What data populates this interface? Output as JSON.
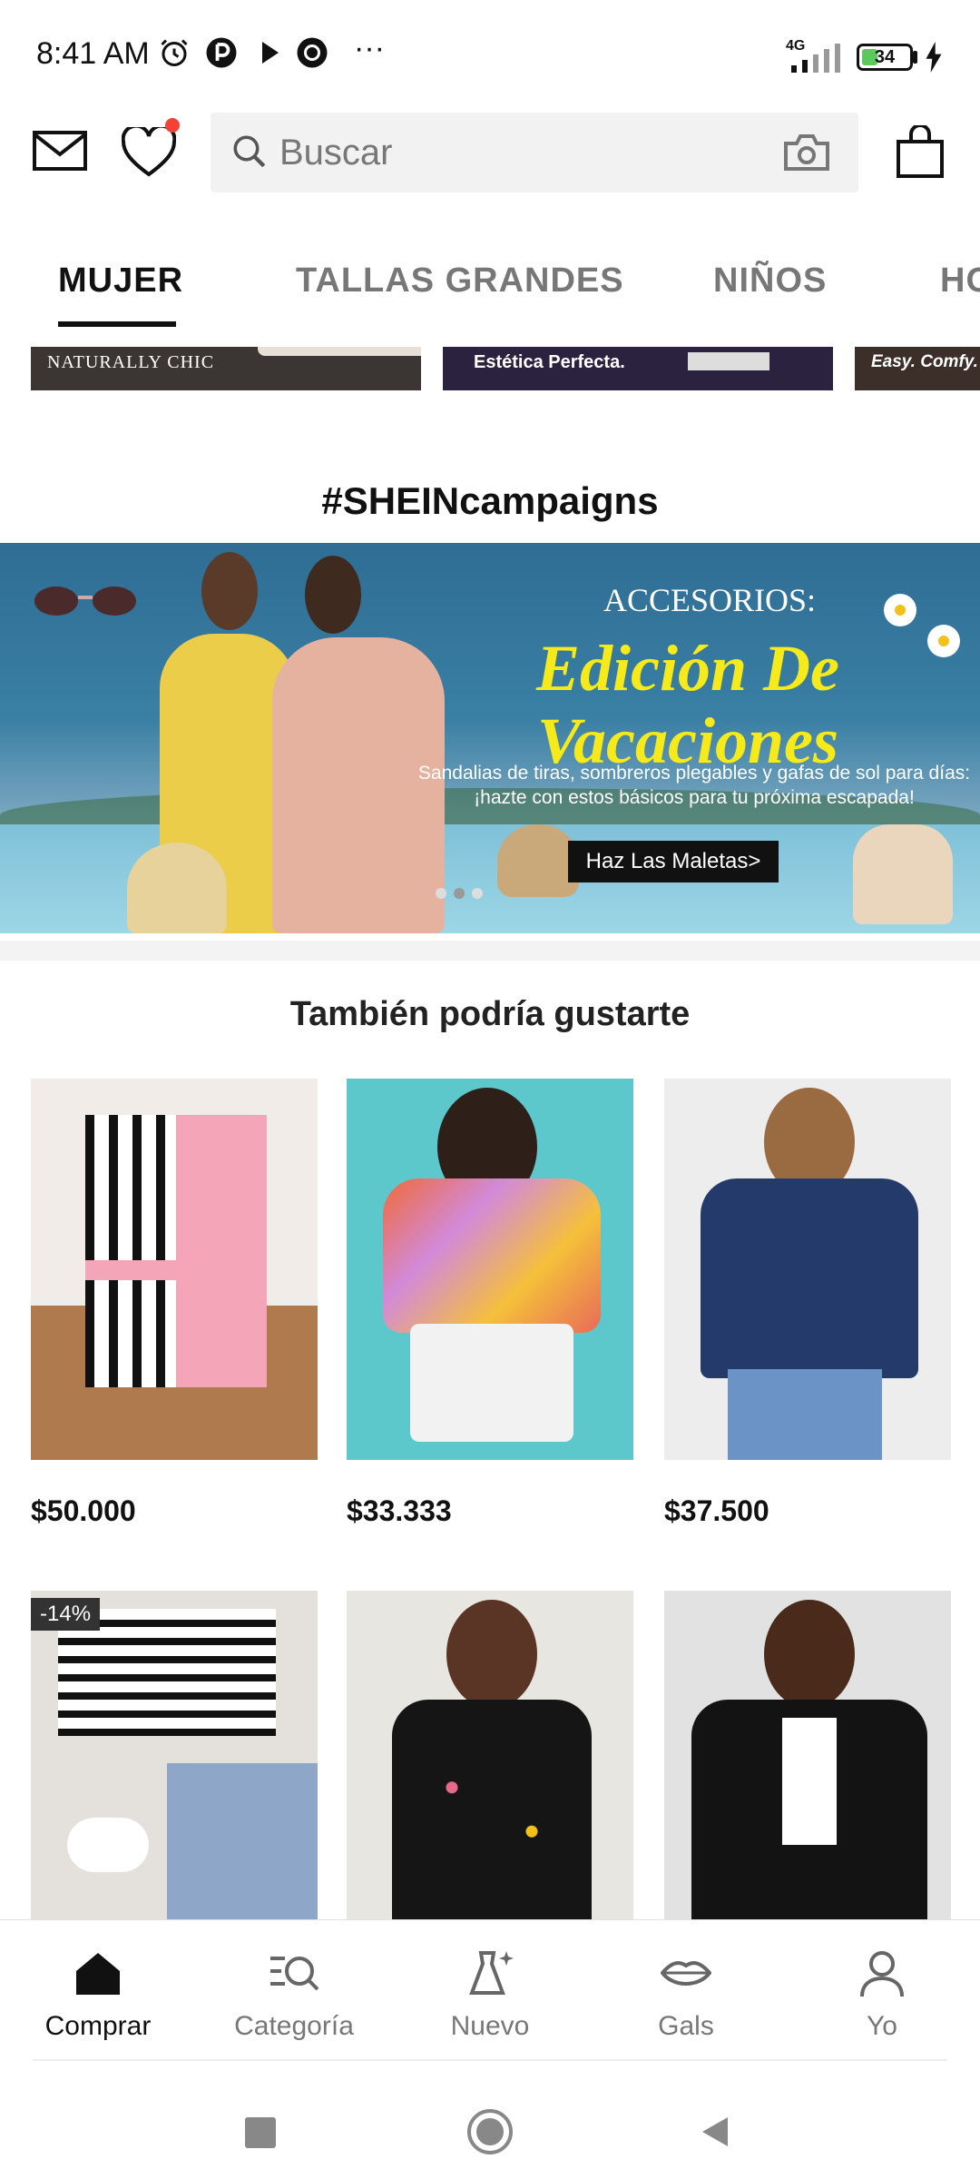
{
  "status_bar": {
    "time": "8:41 AM",
    "more": "···",
    "network": "4G",
    "battery": "34",
    "battery_level": 0.34
  },
  "search": {
    "placeholder": "Buscar"
  },
  "tabs": [
    "MUJER",
    "TALLAS GRANDES",
    "NIÑOS",
    "HO"
  ],
  "mini_strip": [
    "NATURALLY CHIC",
    "Estética Perfecta.",
    "Easy. Comfy. I"
  ],
  "campaigns": {
    "title": "#SHEINcampaigns",
    "kicker": "ACCESORIOS:",
    "headline": "Edición De Vacaciones",
    "description": "Sandalias de tiras, sombreros plegables y gafas de sol para días: ¡hazte con estos básicos para tu próxima escapada!",
    "cta": "Haz Las Maletas>"
  },
  "recommendations": {
    "title": "También podría gustarte",
    "products": [
      {
        "price": "$50.000",
        "badge": ""
      },
      {
        "price": "$33.333",
        "badge": ""
      },
      {
        "price": "$37.500",
        "badge": ""
      },
      {
        "price": "",
        "badge": "-14%"
      },
      {
        "price": "",
        "badge": ""
      },
      {
        "price": "",
        "badge": ""
      }
    ]
  },
  "bottom_nav": [
    {
      "label": "Comprar",
      "icon": "home-icon",
      "active": true
    },
    {
      "label": "Categoría",
      "icon": "category-search-icon",
      "active": false
    },
    {
      "label": "Nuevo",
      "icon": "new-dress-icon",
      "active": false
    },
    {
      "label": "Gals",
      "icon": "lips-icon",
      "active": false
    },
    {
      "label": "Yo",
      "icon": "profile-icon",
      "active": false
    }
  ],
  "colors": {
    "accent_active": "#111111",
    "inactive": "#777777",
    "wishlist_dot": "#f44336",
    "banner_headline": "#f6ea1a"
  }
}
